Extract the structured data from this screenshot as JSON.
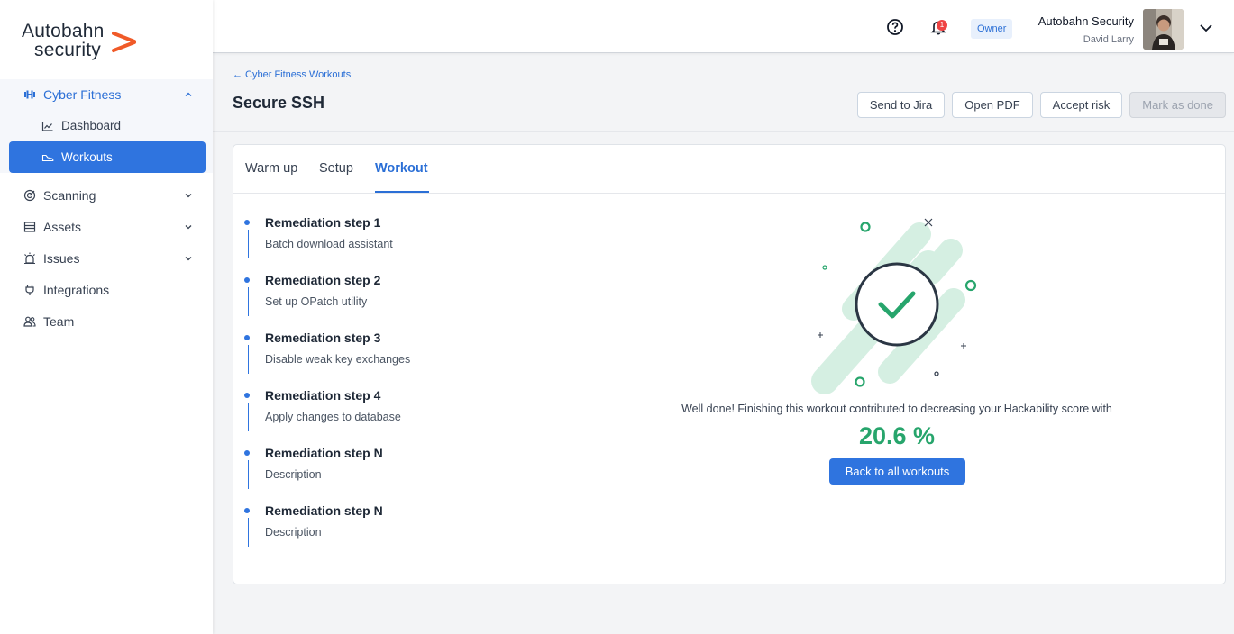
{
  "brand": {
    "line1": "Autobahn",
    "line2": "security",
    "accent": "#f05a28"
  },
  "sidebar": {
    "items": [
      {
        "label": "Cyber Fitness",
        "icon": "dumbbell-icon",
        "expanded": true
      },
      {
        "label": "Scanning",
        "icon": "radar-icon"
      },
      {
        "label": "Assets",
        "icon": "server-icon"
      },
      {
        "label": "Issues",
        "icon": "alarm-icon"
      },
      {
        "label": "Integrations",
        "icon": "plug-icon"
      },
      {
        "label": "Team",
        "icon": "users-icon"
      }
    ],
    "sub": [
      {
        "label": "Dashboard",
        "icon": "chart-line-icon"
      },
      {
        "label": "Workouts",
        "icon": "sneaker-icon",
        "active": true
      }
    ]
  },
  "header": {
    "notifications": "1",
    "role": "Owner",
    "org": "Autobahn Security",
    "user": "David Larry"
  },
  "page": {
    "back": "← Cyber Fitness Workouts",
    "title": "Secure SSH",
    "actions": [
      "Send to Jira",
      "Open PDF",
      "Accept risk",
      "Mark as done"
    ]
  },
  "tabs": [
    "Warm up",
    "Setup",
    "Workout"
  ],
  "steps": [
    {
      "title": "Remediation step 1",
      "desc": "Batch download assistant"
    },
    {
      "title": "Remediation step 2",
      "desc": "Set up OPatch utility"
    },
    {
      "title": "Remediation step 3",
      "desc": "Disable weak key exchanges"
    },
    {
      "title": "Remediation step 4",
      "desc": "Apply changes to database"
    },
    {
      "title": "Remediation step N",
      "desc": "Description"
    },
    {
      "title": "Remediation step N",
      "desc": "Description"
    }
  ],
  "result": {
    "message": "Well done! Finishing this workout contributed to decreasing your Hackability score with",
    "score": "20.6 %",
    "cta": "Back to all workouts"
  },
  "colors": {
    "primary": "#2f74df",
    "success": "#27a56c",
    "alert": "#ef4444"
  }
}
